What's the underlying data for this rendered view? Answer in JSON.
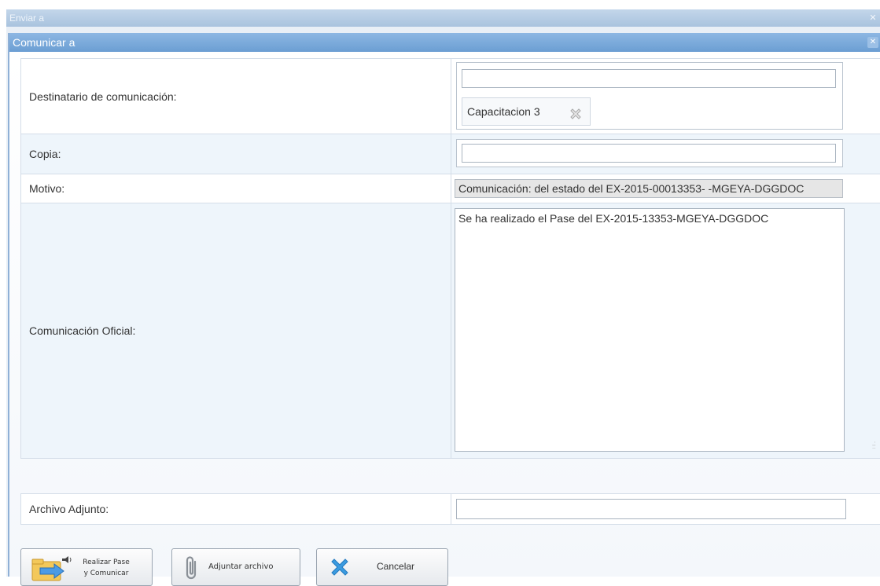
{
  "outer_window": {
    "title": "Enviar a",
    "close_label": "✕"
  },
  "dialog": {
    "title": "Comunicar a",
    "close_label": "✕"
  },
  "form": {
    "destinatario_label": "Destinatario de comunicación:",
    "destinatario_value": "",
    "destinatario_tag": "Capacitacion 3",
    "copia_label": "Copia:",
    "copia_value": "",
    "motivo_label": "Motivo:",
    "motivo_value": "Comunicación: del estado del EX-2015-00013353-   -MGEYA-DGGDOC",
    "comunicacion_label": "Comunicación Oficial:",
    "comunicacion_value": "Se ha realizado el Pase del EX-2015-13353-MGEYA-DGGDOC",
    "archivo_label": "Archivo Adjunto:",
    "archivo_value": ""
  },
  "buttons": {
    "realizar_line1": "Realizar Pase",
    "realizar_line2": "y Comunicar",
    "adjuntar": "Adjuntar archivo",
    "cancelar": "Cancelar"
  },
  "icons": {
    "realizar": "folder-arrow-speaker-icon",
    "adjuntar": "paperclip-icon",
    "cancelar": "blue-x-icon",
    "tag_remove": "gray-x-icon"
  },
  "colors": {
    "dialog_title": "#6b9ed3",
    "cancel_icon": "#3b9be0"
  }
}
